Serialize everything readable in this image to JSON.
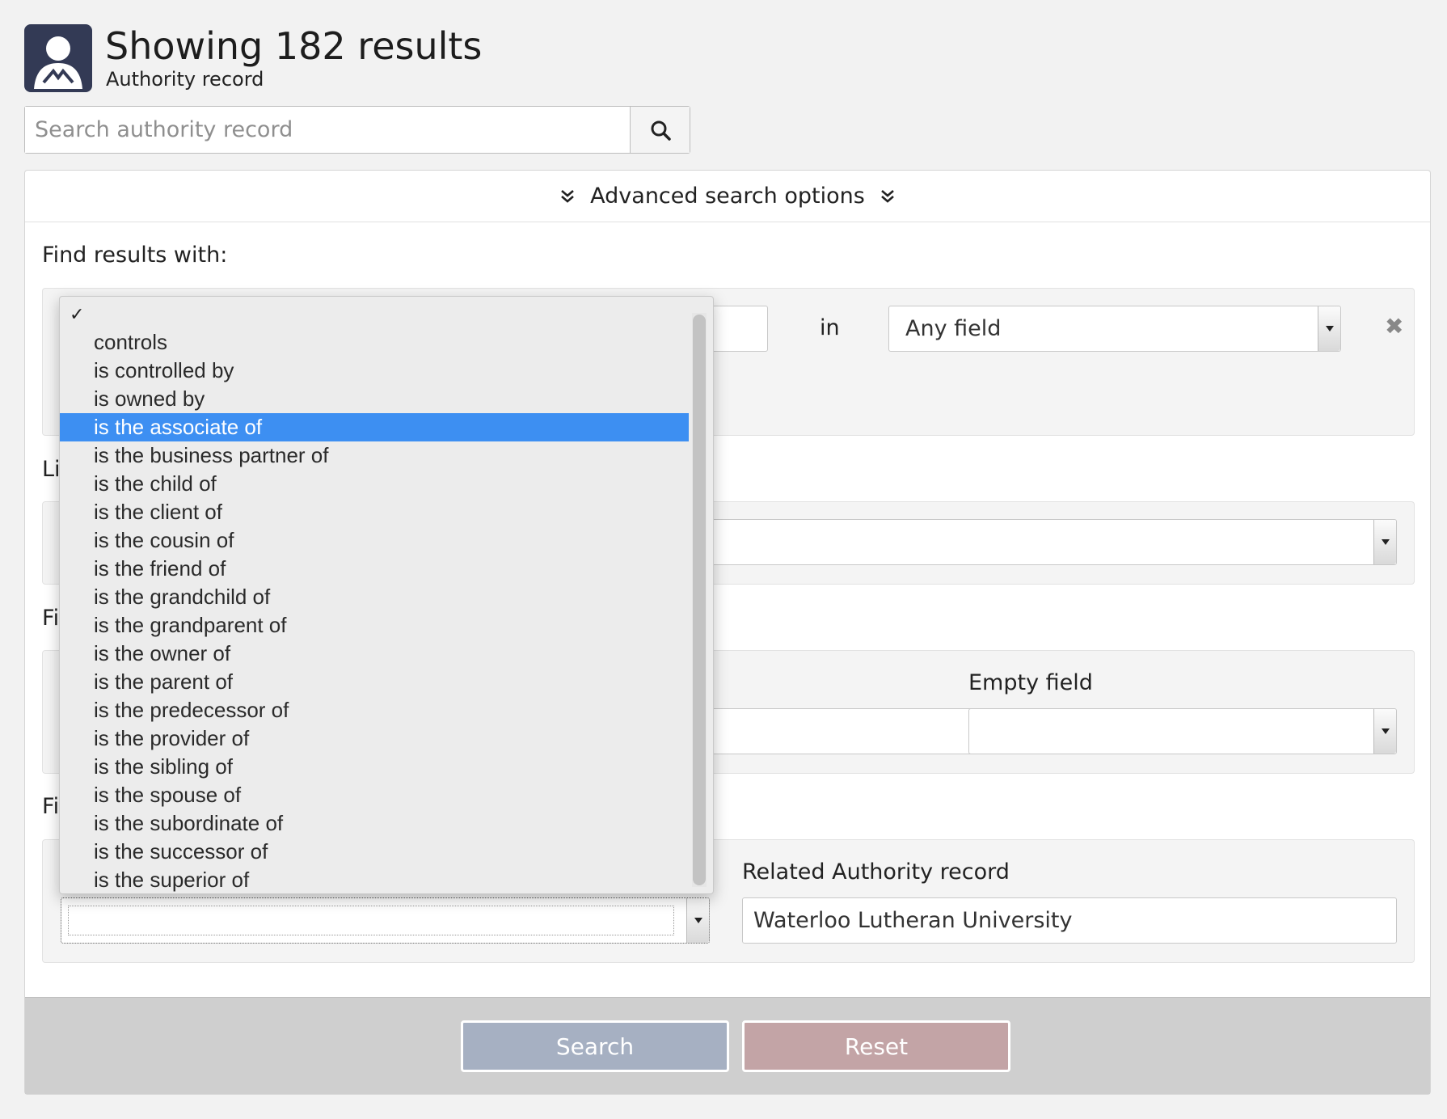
{
  "header": {
    "title": "Showing 182 results",
    "subtitle": "Authority record"
  },
  "search": {
    "placeholder": "Search authority record"
  },
  "advanced": {
    "toggle_label": "Advanced search options",
    "find_results_label": "Find results with:",
    "in_label": "in",
    "field_select_value": "Any field",
    "label_li_partial": "Li",
    "label_fi_partial_1": "Fi",
    "label_fi_partial_2": "Fi",
    "empty_field_label": "Empty field",
    "related_authority_label": "Related Authority record",
    "related_authority_value": "Waterloo Lutheran University"
  },
  "relationship_dropdown": {
    "check_mark": "✓",
    "selected_index": 3,
    "options": [
      "",
      "controls",
      "is controlled by",
      "is owned by",
      "is the associate of",
      "is the business partner of",
      "is the child of",
      "is the client of",
      "is the cousin of",
      "is the friend of",
      "is the grandchild of",
      "is the grandparent of",
      "is the owner of",
      "is the parent of",
      "is the predecessor of",
      "is the provider of",
      "is the sibling of",
      "is the spouse of",
      "is the subordinate of",
      "is the successor of",
      "is the superior of"
    ]
  },
  "buttons": {
    "search": "Search",
    "reset": "Reset"
  },
  "colors": {
    "search_button": "#a6b0c2",
    "reset_button": "#c3a4a6",
    "highlight": "#3d8ff2"
  }
}
